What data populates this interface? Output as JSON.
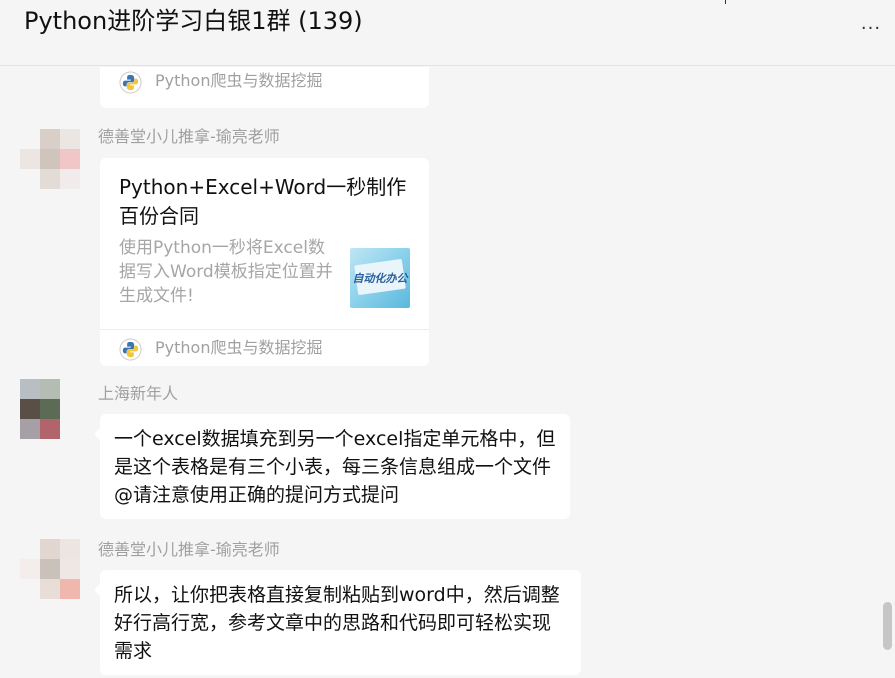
{
  "header": {
    "title": "Python进阶学习白银1群 (139)",
    "more_label": "···"
  },
  "messages": [
    {
      "type": "card-tail",
      "card": {
        "source": "Python爬虫与数据挖掘"
      }
    },
    {
      "type": "card",
      "sender": "德善堂小儿推拿-瑜亮老师",
      "card": {
        "title": "Python+Excel+Word一秒制作百份合同",
        "description": "使用Python一秒将Excel数据写入Word模板指定位置并生成文件!",
        "thumb_text": "自动化办公",
        "source": "Python爬虫与数据挖掘"
      }
    },
    {
      "type": "text",
      "sender": "上海新年人",
      "text": "一个excel数据填充到另一个excel指定单元格中，但是这个表格是有三个小表，每三条信息组成一个文件@请注意使用正确的提问方式提问"
    },
    {
      "type": "text",
      "sender": "德善堂小儿推拿-瑜亮老师",
      "text": "所以，让你把表格直接复制粘贴到word中，然后调整好行高行宽，参考文章中的思路和代码即可轻松实现需求"
    }
  ],
  "colors": {
    "background": "#f5f5f5",
    "bubble": "#ffffff",
    "sender_text": "#a0a0a0",
    "python_blue": "#3a75b0",
    "python_yellow": "#f4c534"
  }
}
